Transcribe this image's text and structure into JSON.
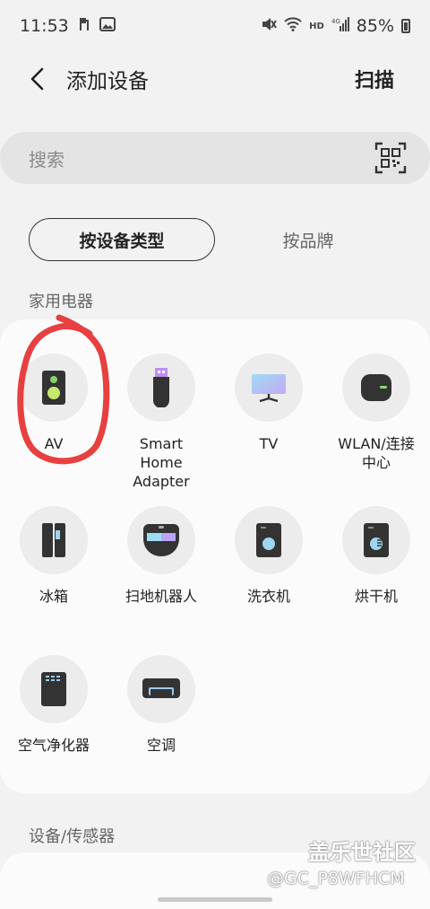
{
  "status_bar": {
    "time": "11:53",
    "left_icons": [
      "hearing-icon",
      "image-icon"
    ],
    "right_icons": [
      "mute-icon",
      "wifi-icon",
      "hd-icon",
      "signal-4g-icon"
    ],
    "battery": "85%",
    "hd_text": "HD",
    "net_text": "4G"
  },
  "header": {
    "title": "添加设备",
    "scan_label": "扫描"
  },
  "search": {
    "placeholder": "搜索"
  },
  "toggle": {
    "by_type": "按设备类型",
    "by_brand": "按品牌",
    "selected": "by_type"
  },
  "sections": {
    "appliances": "家用电器",
    "sensors": "设备/传感器"
  },
  "appliances": [
    {
      "label": "AV",
      "icon": "speaker-icon"
    },
    {
      "label": "Smart\nHome\nAdapter",
      "icon": "usb-adapter-icon"
    },
    {
      "label": "TV",
      "icon": "tv-icon"
    },
    {
      "label": "WLAN/连接\n中心",
      "icon": "hub-icon"
    },
    {
      "label": "冰箱",
      "icon": "fridge-icon"
    },
    {
      "label": "扫地机器人",
      "icon": "robot-vacuum-icon"
    },
    {
      "label": "洗衣机",
      "icon": "washer-icon"
    },
    {
      "label": "烘干机",
      "icon": "dryer-icon"
    },
    {
      "label": "空气净化器",
      "icon": "air-purifier-icon"
    },
    {
      "label": "空调",
      "icon": "air-conditioner-icon"
    }
  ],
  "watermark": {
    "site": "盖乐世社区",
    "user": "@GC_P8WFHCM"
  },
  "colors": {
    "background": "#f2f2f2",
    "card": "#fbfbfb",
    "icon_dark": "#333333",
    "annotation": "#e53030"
  }
}
